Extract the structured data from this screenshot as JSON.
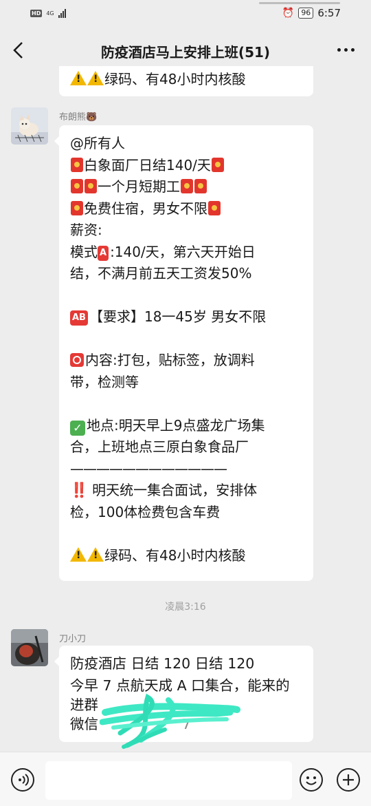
{
  "status_bar": {
    "network": "HD",
    "network_type": "4G",
    "battery": "96",
    "time": "6:57"
  },
  "header": {
    "title": "防疫酒店马上安排上班(51)"
  },
  "prev_message": {
    "tail_text": "绿码、有48小时内核酸"
  },
  "message1": {
    "sender": "布朗熊🐻",
    "lines": {
      "l1": "@所有人",
      "l2": "白象面厂日结140/天",
      "l3": "一个月短期工",
      "l4": "免费住宿，男女不限",
      "l5": "薪资:",
      "l6a": "模式",
      "l6b": ":140/天，第六天开始日",
      "l7": "结，不满月前五天工资发50%",
      "l8badge": "AB",
      "l8": "【要求】18一45岁 男女不限",
      "l9": "内容:打包，贴标签，放调料",
      "l10": "带，检测等",
      "l11": "地点:明天早上9点盛龙广场集",
      "l12": "合，上班地点三原白象食品厂",
      "l13": "————————————",
      "l14a": "‼️",
      "l14": "明天统一集合面试，安排体",
      "l15": "检，100体检费包含车费",
      "l16": "绿码、有48小时内核酸"
    },
    "badge_a": "A"
  },
  "timestamp": "凌晨3:16",
  "message2": {
    "sender": "刀小刀",
    "lines": {
      "l1": "防疫酒店 日结 120 日结 120",
      "l2": "今早 7 点航天成 A 口集合，能来的",
      "l3": "进群",
      "l4": "微信",
      "l4_tail": "7"
    }
  },
  "input_bar": {
    "placeholder": ""
  },
  "icons": {
    "back": "chevron-left-icon",
    "more": "more-dots-icon",
    "voice": "voice-icon",
    "emoji": "emoji-icon",
    "plus": "plus-icon"
  },
  "colors": {
    "background": "#ededed",
    "bubble": "#ffffff",
    "accent_scribble": "#3fe8c4"
  }
}
